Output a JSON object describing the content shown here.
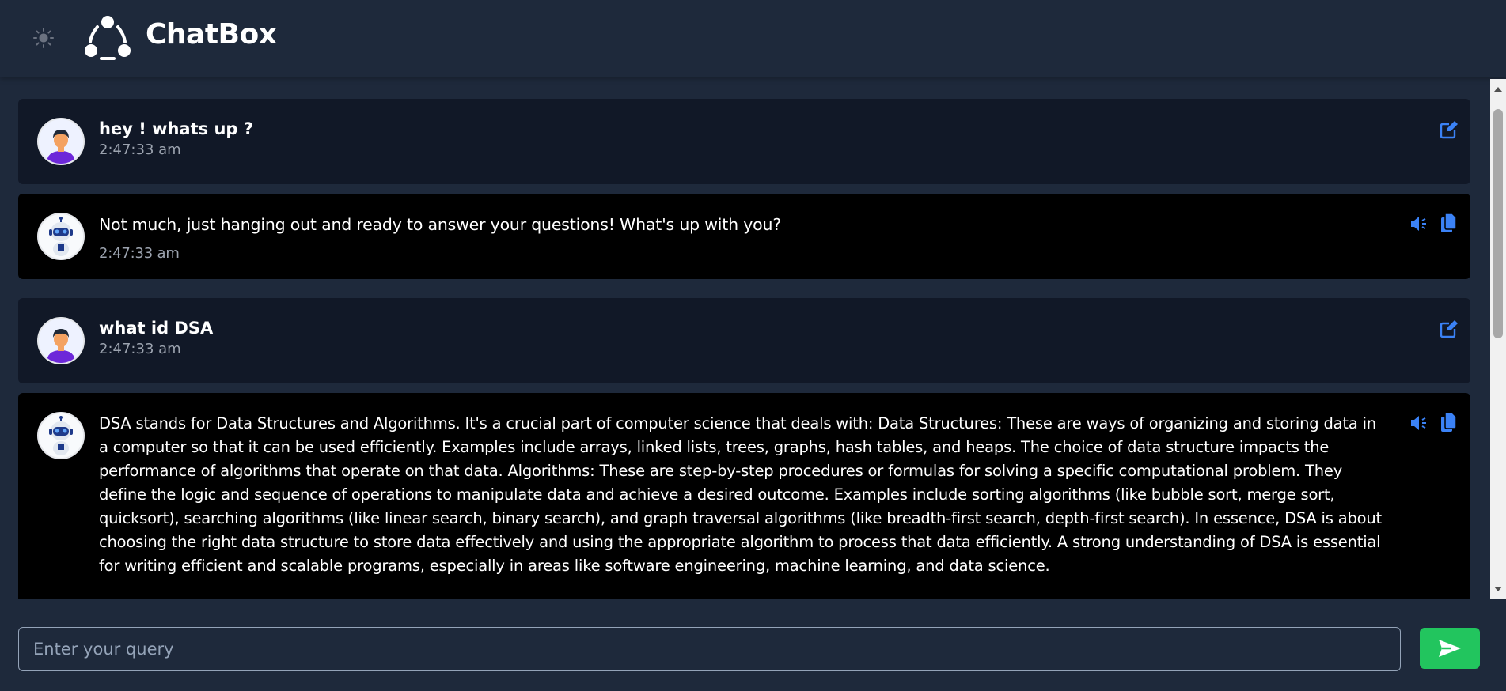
{
  "app": {
    "title": "ChatBox"
  },
  "colors": {
    "accent": "#3b82f6",
    "send": "#22c55e",
    "bot_bg": "#000000",
    "user_bg": "#111827",
    "page_bg": "#1e293b"
  },
  "messages": [
    {
      "role": "user",
      "text": "hey ! whats up ?",
      "time": "2:47:33 am",
      "avatar_icon": "user-avatar-icon",
      "actions": [
        "edit-icon"
      ]
    },
    {
      "role": "bot",
      "text": "Not much, just hanging out and ready to answer your questions! What's up with you?",
      "time": "2:47:33 am",
      "avatar_icon": "robot-avatar-icon",
      "actions": [
        "speaker-icon",
        "copy-icon"
      ]
    },
    {
      "role": "user",
      "text": "what id DSA",
      "time": "2:47:33 am",
      "avatar_icon": "user-avatar-icon",
      "actions": [
        "edit-icon"
      ]
    },
    {
      "role": "bot",
      "text": "DSA stands for Data Structures and Algorithms. It's a crucial part of computer science that deals with: Data Structures: These are ways of organizing and storing data in a computer so that it can be used efficiently. Examples include arrays, linked lists, trees, graphs, hash tables, and heaps. The choice of data structure impacts the performance of algorithms that operate on that data. Algorithms: These are step-by-step procedures or formulas for solving a specific computational problem. They define the logic and sequence of operations to manipulate data and achieve a desired outcome. Examples include sorting algorithms (like bubble sort, merge sort, quicksort), searching algorithms (like linear search, binary search), and graph traversal algorithms (like breadth-first search, depth-first search). In essence, DSA is about choosing the right data structure to store data effectively and using the appropriate algorithm to process that data efficiently. A strong understanding of DSA is essential for writing efficient and scalable programs, especially in areas like software engineering, machine learning, and data science.",
      "avatar_icon": "robot-avatar-icon",
      "actions": [
        "speaker-icon",
        "copy-icon"
      ]
    }
  ],
  "input": {
    "placeholder": "Enter your query",
    "value": ""
  }
}
